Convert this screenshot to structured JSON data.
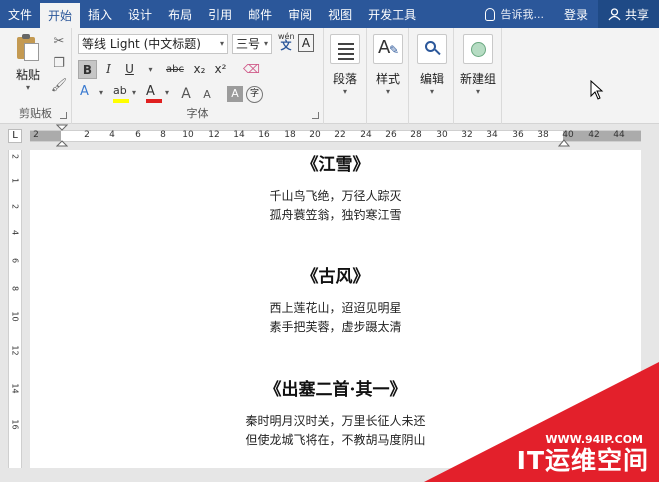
{
  "tabs": [
    "文件",
    "开始",
    "插入",
    "设计",
    "布局",
    "引用",
    "邮件",
    "审阅",
    "视图",
    "开发工具"
  ],
  "tell_me": "告诉我...",
  "login": "登录",
  "share": "共享",
  "clipboard": {
    "paste_label": "粘贴",
    "group_label": "剪贴板"
  },
  "font": {
    "name": "等线 Light (中文标题)",
    "size": "三号",
    "wen_top": "wén",
    "wen_char": "文",
    "frame_char": "A",
    "bold": "B",
    "italic": "I",
    "underline": "U",
    "strike": "abc",
    "sub": "x₂",
    "sup": "x²",
    "text_effect": "A",
    "highlight": "ab",
    "font_color": "A",
    "grow": "A",
    "shrink": "A",
    "shade": "A",
    "enclose": "字",
    "group_label": "字体"
  },
  "paragraph": {
    "label": "段落"
  },
  "styles": {
    "label": "样式"
  },
  "editing": {
    "label": "编辑"
  },
  "newgroup": {
    "label": "新建组"
  },
  "ruler_corner": "L",
  "ruler_h": [
    "2",
    "2",
    "4",
    "6",
    "8",
    "10",
    "12",
    "14",
    "16",
    "18",
    "20",
    "22",
    "24",
    "26",
    "28",
    "30",
    "32",
    "34",
    "36",
    "38",
    "40",
    "42",
    "44"
  ],
  "ruler_v": [
    "2",
    "1",
    "2",
    "4",
    "6",
    "8",
    "10",
    "12",
    "14",
    "16"
  ],
  "poems": [
    {
      "title": "《江雪》",
      "lines": [
        "千山鸟飞绝，万径人踪灭",
        "孤舟蓑笠翁，独钓寒江雪"
      ]
    },
    {
      "title": "《古风》",
      "lines": [
        "西上莲花山，迢迢见明星",
        "素手把芙蓉，虚步蹑太清"
      ]
    },
    {
      "title": "《出塞二首·其一》",
      "lines": [
        "秦时明月汉时关，万里长征人未还",
        "但使龙城飞将在，不教胡马度阴山"
      ]
    }
  ],
  "watermark": {
    "url": "WWW.94IP.COM",
    "brand": "IT运维空间"
  },
  "colors": {
    "brand": "#2b579a",
    "highlight": "#ffff00",
    "font_red": "#e02020",
    "watermark": "#e3202b"
  }
}
